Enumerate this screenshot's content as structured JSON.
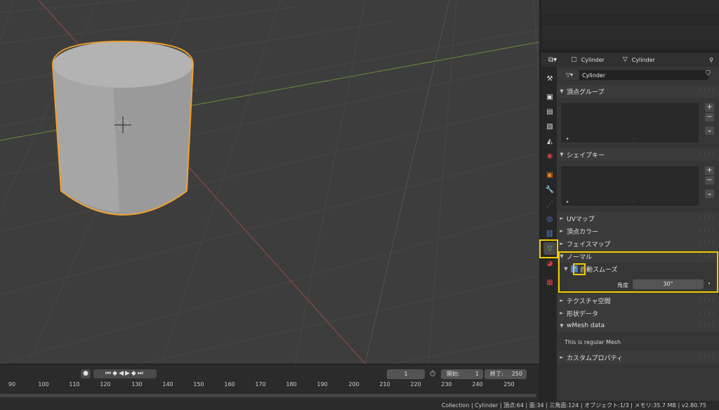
{
  "properties": {
    "header": {
      "object_name": "Cylinder",
      "data_name": "Cylinder"
    },
    "mesh_name": "Cylinder",
    "panels": {
      "vertex_groups": "頂点グループ",
      "shape_keys": "シェイプキー",
      "uv_maps": "UVマップ",
      "vertex_colors": "頂点カラー",
      "face_maps": "フェイスマップ",
      "normals": "ノーマル",
      "auto_smooth": "自動スムーズ",
      "angle_label": "角度",
      "angle_value": "30°",
      "texture_space": "テクスチャ空間",
      "shape_data": "形状データ",
      "wmesh_data": "wMesh data",
      "wmesh_text": "This is regular Mesh",
      "custom_props": "カスタムプロパティ"
    }
  },
  "timeline": {
    "current_frame": "1",
    "start_label": "開始:",
    "start_value": "1",
    "end_label": "終了:",
    "end_value": "250",
    "ruler": [
      "90",
      "100",
      "110",
      "120",
      "130",
      "140",
      "150",
      "160",
      "170",
      "180",
      "190",
      "200",
      "210",
      "220",
      "230",
      "240",
      "250"
    ]
  },
  "status": {
    "text": "Collection | Cylinder | 頂点:64 | 面:34 | 三角面:124 | オブジェクト:1/3 | メモリ:35.7 MB | v2.80.75"
  },
  "colors": {
    "accent": "#f2cc00",
    "selection_outline": "#ffa020",
    "checkbox": "#4a82c8"
  }
}
